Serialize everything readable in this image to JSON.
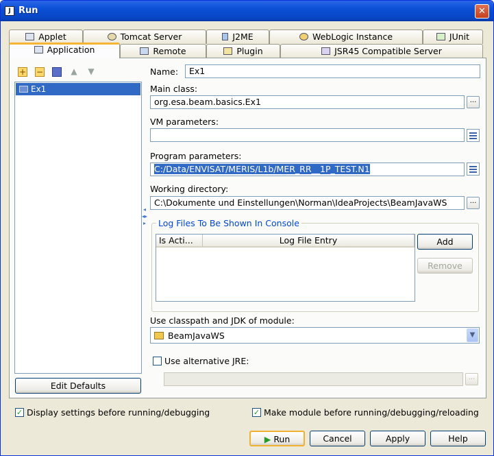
{
  "window": {
    "title": "Run",
    "close_symbol": "✕"
  },
  "tabs_back": [
    "Applet",
    "Tomcat Server",
    "J2ME",
    "WebLogic Instance",
    "JUnit"
  ],
  "tabs_front": [
    "Application",
    "Remote",
    "Plugin",
    "JSR45 Compatible Server"
  ],
  "tree": {
    "items": [
      "Ex1"
    ]
  },
  "buttons": {
    "edit_defaults": "Edit Defaults",
    "add": "Add",
    "remove": "Remove",
    "run": "Run",
    "cancel": "Cancel",
    "apply": "Apply",
    "help": "Help"
  },
  "form": {
    "name_label": "Name:",
    "name_value": "Ex1",
    "main_class_label": "Main class:",
    "main_class_value": "org.esa.beam.basics.Ex1",
    "vm_params_label": "VM parameters:",
    "vm_params_value": "",
    "program_params_label": "Program parameters:",
    "program_params_value": "C:/Data/ENVISAT/MERIS/L1b/MER_RR__1P_TEST.N1",
    "working_dir_label": "Working directory:",
    "working_dir_value": "C:\\Dokumente und Einstellungen\\Norman\\IdeaProjects\\BeamJavaWS",
    "log_group_title": "Log Files To Be Shown In Console",
    "log_columns": [
      "Is Acti...",
      "Log File Entry"
    ],
    "module_label": "Use classpath and JDK of module:",
    "module_value": "BeamJavaWS",
    "alt_jre_label": "Use alternative JRE:",
    "alt_jre_value": ""
  },
  "footer": {
    "display_settings_label": "Display settings before running/debugging",
    "display_settings_checked": true,
    "make_module_label": "Make module before running/debugging/reloading",
    "make_module_checked": true,
    "alt_jre_checked": false
  },
  "icons": {
    "add": "plus-icon",
    "remove": "minus-icon",
    "save": "save-icon",
    "up": "arrow-up-icon",
    "down": "arrow-down-icon"
  }
}
